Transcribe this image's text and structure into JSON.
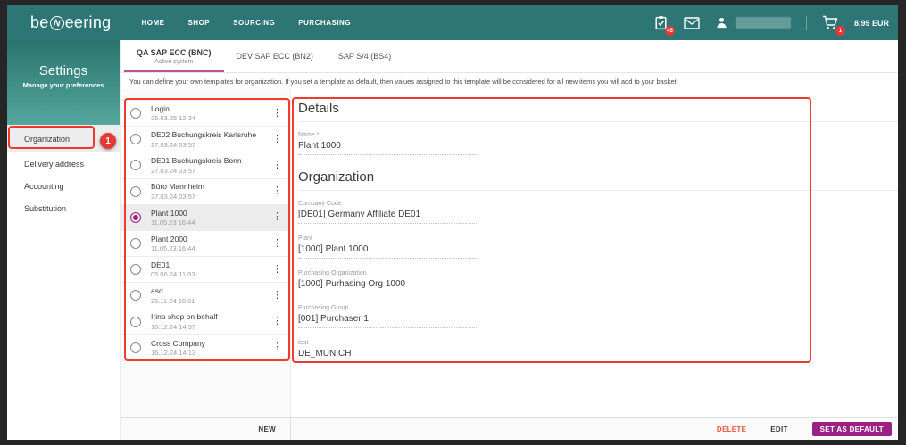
{
  "navbar": {
    "logo": {
      "prefix": "be",
      "n": "N",
      "suffix": "eering"
    },
    "menu": [
      {
        "label": "HOME"
      },
      {
        "label": "SHOP"
      },
      {
        "label": "SOURCING"
      },
      {
        "label": "PURCHASING"
      }
    ],
    "tasks_badge": "45",
    "cart_badge": "1",
    "cart_total": "8,99 EUR"
  },
  "sidebar": {
    "title": "Settings",
    "subtitle": "Manage your preferences",
    "items": [
      {
        "label": "Organization",
        "selected": true
      },
      {
        "label": "Delivery address"
      },
      {
        "label": "Accounting"
      },
      {
        "label": "Substitution"
      }
    ]
  },
  "tabs": [
    {
      "label": "QA SAP ECC (BNC)",
      "subtitle": "Active system",
      "active": true
    },
    {
      "label": "DEV SAP ECC (BN2)"
    },
    {
      "label": "SAP S/4 (BS4)"
    }
  ],
  "description": "You can define your own templates for organization. If you set a template as default, then values assigned to this template will be considered for all new items you will add to your basket.",
  "template_list": {
    "items": [
      {
        "name": "Login",
        "date": "25.03.25 12:34"
      },
      {
        "name": "DE02 Buchungskreis Karlsruhe",
        "date": "27.03.24 03:57"
      },
      {
        "name": "DE01 Buchungskreis Bonn",
        "date": "27.03.24 03:57"
      },
      {
        "name": "Büro Mannheim",
        "date": "27.03.24 03:57"
      },
      {
        "name": "Plant 1000",
        "date": "11.05.23 16:44",
        "selected": true
      },
      {
        "name": "Plant 2000",
        "date": "11.05.23 16:44"
      },
      {
        "name": "DE01",
        "date": "05.06.24 11:03"
      },
      {
        "name": "asd",
        "date": "26.11.24 16:01"
      },
      {
        "name": "Irina shop on behalf",
        "date": "10.12.24 14:57"
      },
      {
        "name": "Cross Company",
        "date": "16.12.24 14:13"
      }
    ]
  },
  "details": {
    "heading": "Details",
    "name_label": "Name *",
    "name_value": "Plant 1000",
    "org_heading": "Organization",
    "fields": [
      {
        "label": "Company Code",
        "value": "[DE01] Germany Affiliate DE01"
      },
      {
        "label": "Plant",
        "value": "[1000] Plant 1000"
      },
      {
        "label": "Purchasing Organization",
        "value": "[1000] Purhasing Org 1000"
      },
      {
        "label": "Purchasing Group",
        "value": "[001] Purchaser 1"
      },
      {
        "label": "test",
        "value": "DE_MUNICH"
      }
    ]
  },
  "footer": {
    "new": "NEW",
    "delete": "DELETE",
    "edit": "EDIT",
    "set_default": "SET AS DEFAULT"
  },
  "annotations": {
    "step": "1"
  },
  "colors": {
    "brand_teal": "#2e7575",
    "accent_magenta": "#9c2184",
    "tab_underline": "#b3539f",
    "annotation_red": "#ee3b2d",
    "badge_red": "#e53935",
    "delete_orange": "#e9573f"
  }
}
